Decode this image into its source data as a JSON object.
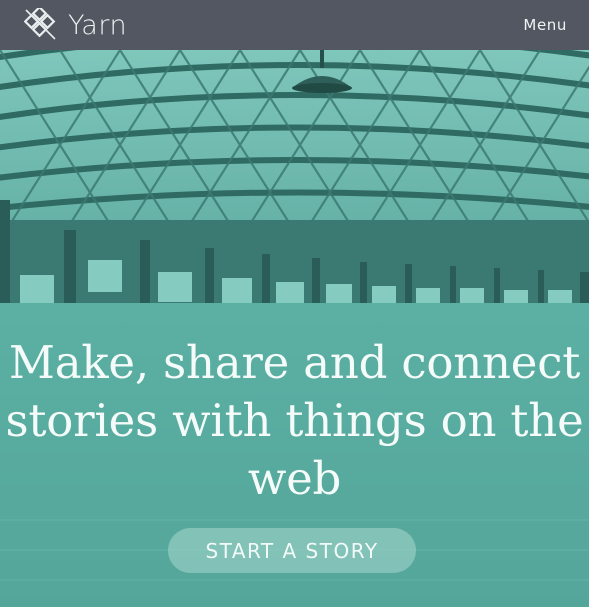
{
  "header": {
    "brand_name": "Yarn",
    "menu_label": "Menu",
    "logo_icon": "yarn-diamond-logo-icon"
  },
  "hero": {
    "headline": "Make, share and connect stories with things on the web",
    "cta_label": "START A STORY",
    "image": "teal-tinted-train-station-roof-photo"
  },
  "colors": {
    "topbar": "#525762",
    "accent_teal": "#5fb4a8",
    "text_light": "#f4fbf9"
  }
}
